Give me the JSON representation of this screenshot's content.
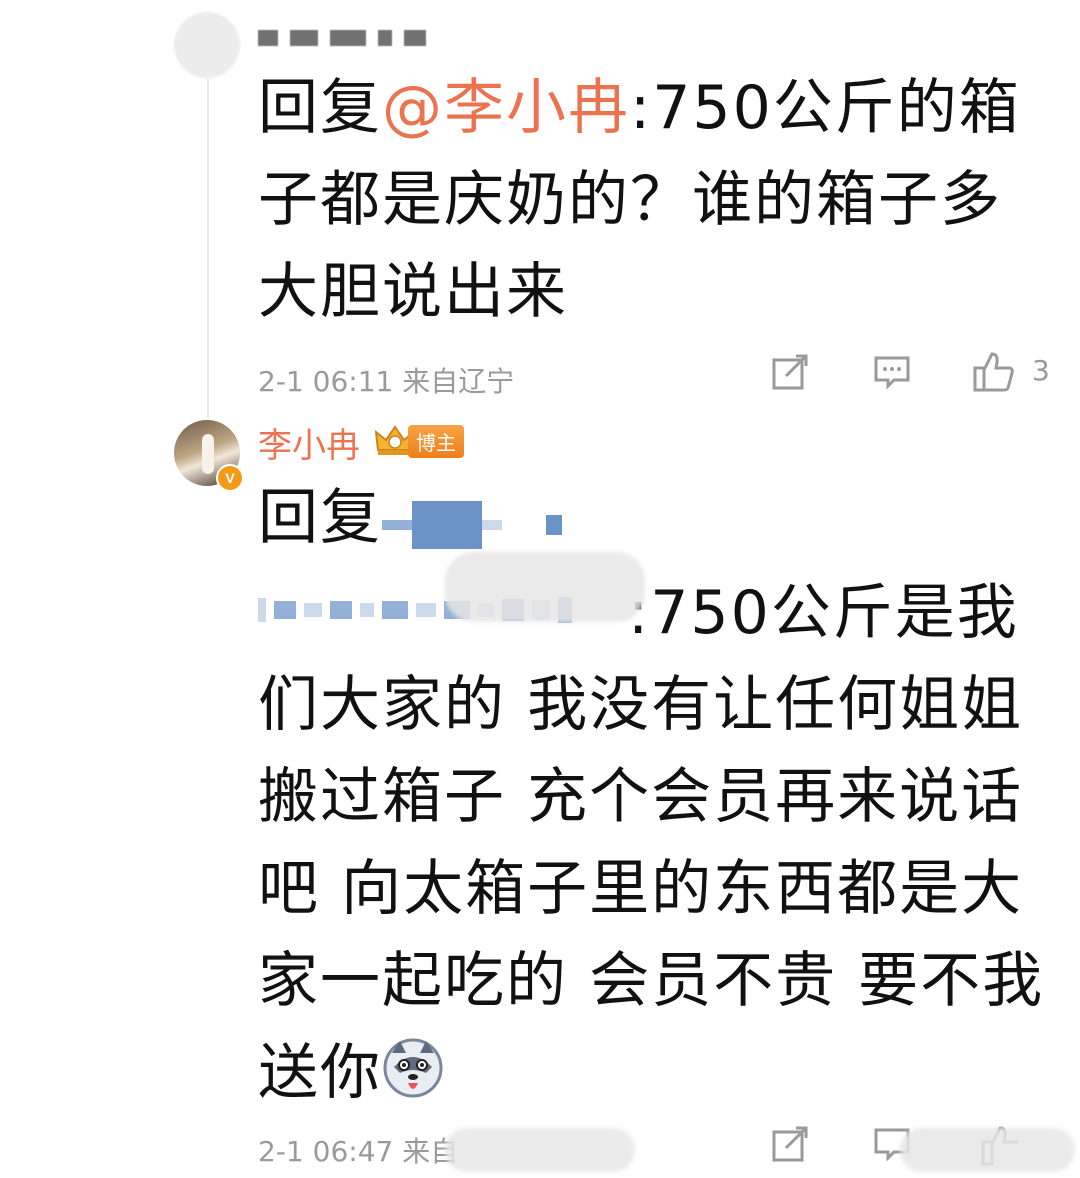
{
  "comment1": {
    "text_prefix": "回复",
    "mention": "@李小冉",
    "text_rest": ":750公斤的箱子都是庆奶的？谁的箱子多大胆说出来",
    "time_location": "2-1 06:11 来自辽宁",
    "like_count": "3"
  },
  "comment2": {
    "username": "李小冉",
    "badge_label": "博主",
    "verified_mark": "V",
    "reply_prefix": "回复",
    "text_rest": ":750公斤是我们大家的 我没有让任何姐姐搬过箱子 充个会员再来说话吧 向太箱子里的东西都是大家一起吃的 会员不贵 要不我送你",
    "time_location": "2-1 06:47 来自"
  },
  "icons": {
    "share": "share-icon",
    "comment": "comment-icon",
    "like": "like-icon",
    "emoji": "husky-emoji-icon"
  },
  "colors": {
    "mention": "#eb7350",
    "meta": "#9a9a9a",
    "badge": "#ef7f1a"
  }
}
